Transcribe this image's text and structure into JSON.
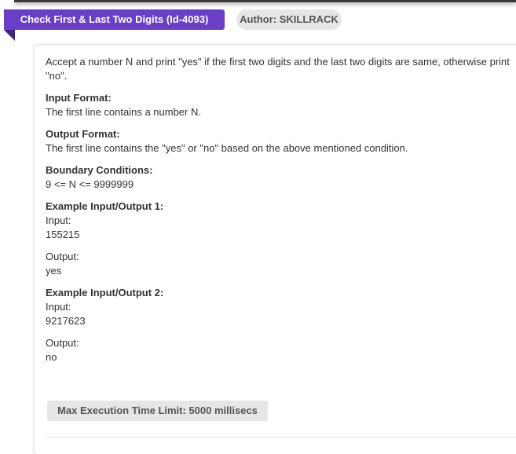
{
  "header": {
    "title": "Check First & Last Two Digits (Id-4093)",
    "author": "Author: SKILLRACK"
  },
  "problem": {
    "description": "Accept a number N and print \"yes\" if the first two digits and the last two digits are same, otherwise print \"no\".",
    "input_format_heading": "Input Format:",
    "input_format_text": "The first line contains a number N.",
    "output_format_heading": "Output Format:",
    "output_format_text": "The first line contains the \"yes\" or \"no\" based on the above mentioned condition.",
    "boundary_heading": "Boundary Conditions:",
    "boundary_text": "9 <= N <= 9999999",
    "examples": [
      {
        "heading": "Example Input/Output 1:",
        "input_label": "Input:",
        "input_value": "155215",
        "output_label": "Output:",
        "output_value": "yes"
      },
      {
        "heading": "Example Input/Output 2:",
        "input_label": "Input:",
        "input_value": "9217623",
        "output_label": "Output:",
        "output_value": "no"
      }
    ]
  },
  "footer": {
    "exec_limit": "Max Execution Time Limit: 5000 millisecs"
  },
  "colors": {
    "ribbon": "#6a3fc7",
    "ribbon_fold": "#3f2388",
    "pill_bg": "#e6e6e6",
    "text": "#333333"
  }
}
